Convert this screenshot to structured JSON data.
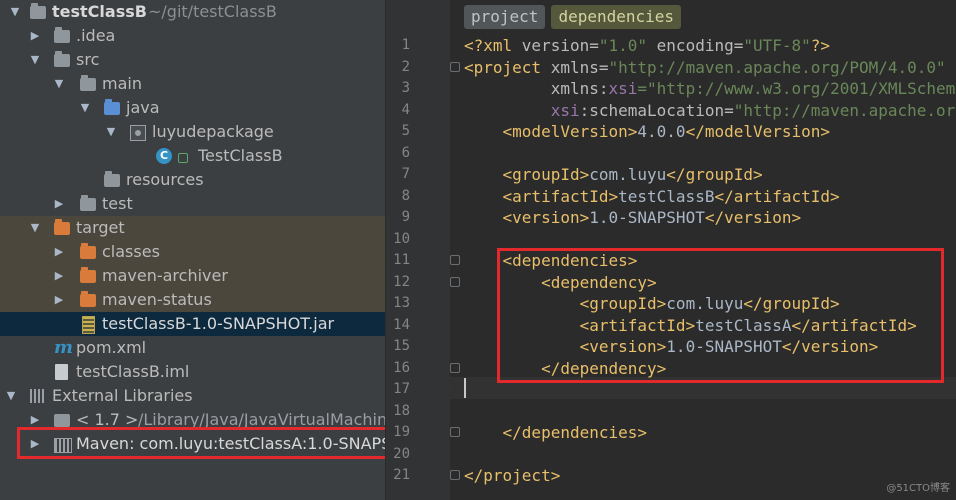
{
  "project_tree": {
    "root": {
      "name": "testClassB",
      "path": "~/git/testClassB"
    },
    "items": [
      {
        "label": "testClassB",
        "sub": "~/git/testClassB"
      },
      {
        "label": ".idea"
      },
      {
        "label": "src"
      },
      {
        "label": "main"
      },
      {
        "label": "java"
      },
      {
        "label": "luyudepackage"
      },
      {
        "label": "TestClassB",
        "badge": "C"
      },
      {
        "label": "resources"
      },
      {
        "label": "test"
      },
      {
        "label": "target"
      },
      {
        "label": "classes"
      },
      {
        "label": "maven-archiver"
      },
      {
        "label": "maven-status"
      },
      {
        "label": "testClassB-1.0-SNAPSHOT.jar"
      },
      {
        "label": "pom.xml",
        "icon_text": "m"
      },
      {
        "label": "testClassB.iml"
      },
      {
        "label": "External Libraries"
      },
      {
        "label": "< 1.7 >",
        "sub": "/Library/Java/JavaVirtualMachin"
      },
      {
        "label": "Maven: com.luyu:testClassA:1.0-SNAPS"
      }
    ]
  },
  "editor": {
    "breadcrumbs": [
      "project",
      "dependencies"
    ],
    "line_numbers": [
      "1",
      "2",
      "3",
      "4",
      "5",
      "6",
      "7",
      "8",
      "9",
      "10",
      "11",
      "12",
      "13",
      "14",
      "15",
      "16",
      "17",
      "18",
      "19",
      "20",
      "21"
    ]
  },
  "watermark": "@51CTO博客",
  "colors": {
    "highlight_box": "#e3292c",
    "xml_tag": "#e8bf6a",
    "xml_value": "#6a8759",
    "xml_namespace": "#9876aa"
  }
}
